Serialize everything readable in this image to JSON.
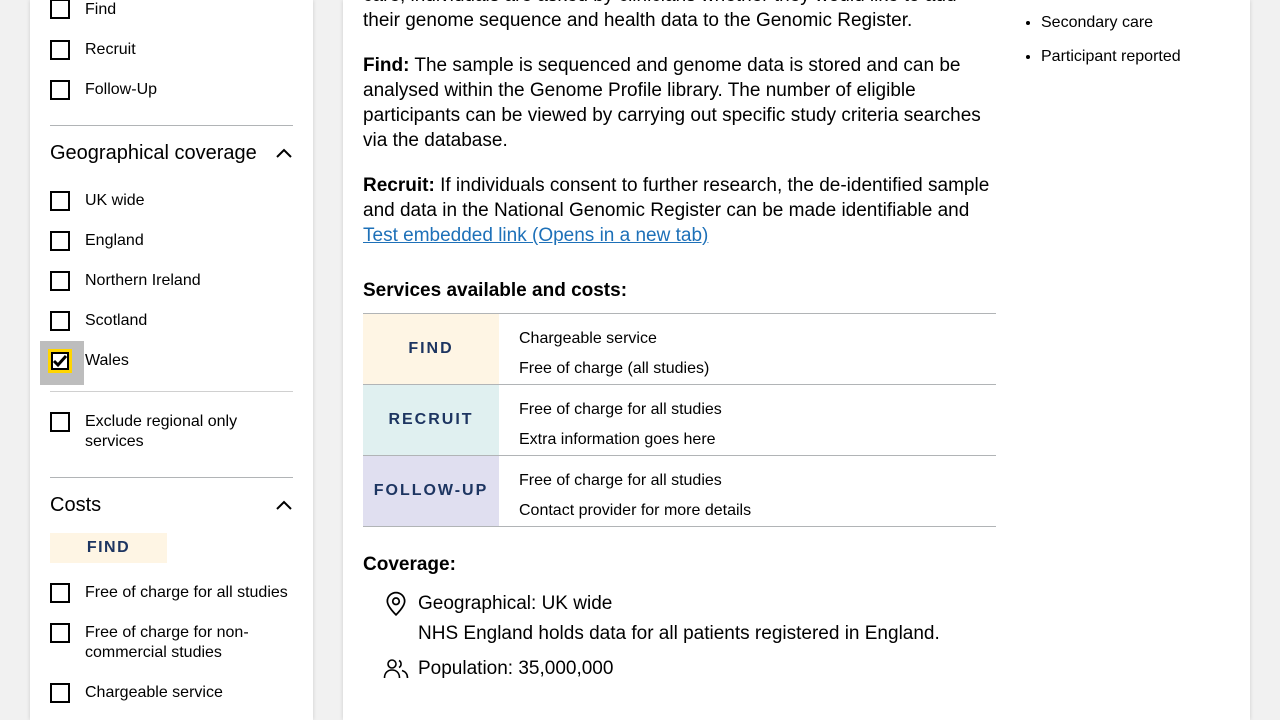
{
  "filters": {
    "type_options": [
      {
        "label": "Find",
        "checked": false
      },
      {
        "label": "Recruit",
        "checked": false
      },
      {
        "label": "Follow-Up",
        "checked": false
      }
    ],
    "geo_title": "Geographical coverage",
    "geo_options": [
      {
        "label": "UK wide",
        "checked": false
      },
      {
        "label": "England",
        "checked": false
      },
      {
        "label": "Northern Ireland",
        "checked": false
      },
      {
        "label": "Scotland",
        "checked": false
      },
      {
        "label": "Wales",
        "checked": true
      }
    ],
    "exclude_label": "Exclude regional only services",
    "costs_title": "Costs",
    "costs_tag": "FIND",
    "cost_options": [
      {
        "label": "Free of charge for all studies",
        "checked": false
      },
      {
        "label": "Free of charge for non-commercial studies",
        "checked": false
      },
      {
        "label": "Chargeable service",
        "checked": false
      }
    ]
  },
  "main": {
    "intro_partial": "care, individuals are asked by clinicians whether they would like to add their genome sequence and health data to the Genomic Register.",
    "find_label": "Find:",
    "find_text": " The sample is sequenced and genome data is stored and can be analysed within the Genome Profile library. The number of eligible participants can be viewed by carrying out specific study criteria searches via the database.",
    "recruit_label": "Recruit:",
    "recruit_text": " If individuals consent to further research, the de-identified sample and data in the National Genomic Register can be made identifiable and ",
    "link_text": "Test embedded link (Opens in a new tab)",
    "services_heading": "Services available and costs:",
    "services": [
      {
        "tag": "FIND",
        "color": "#fef5e4",
        "lines": [
          "Chargeable service",
          "Free of charge (all studies)"
        ]
      },
      {
        "tag": "RECRUIT",
        "color": "#e0f0f0",
        "lines": [
          "Free of charge for all studies",
          "Extra information goes here"
        ]
      },
      {
        "tag": "FOLLOW-UP",
        "color": "#e0dff0",
        "lines": [
          "Free of charge for all studies",
          "Contact provider for more details"
        ]
      }
    ],
    "coverage_heading": "Coverage:",
    "geo_line": "Geographical: UK wide",
    "geo_note": "NHS England holds data for all patients registered in England.",
    "population_line": "Population: 35,000,000"
  },
  "sidebar_list": [
    "Secondary care",
    "Participant reported"
  ],
  "colors": {
    "tag_text": "#1d3561",
    "link": "#1d70b8",
    "focus": "#ffd500"
  }
}
